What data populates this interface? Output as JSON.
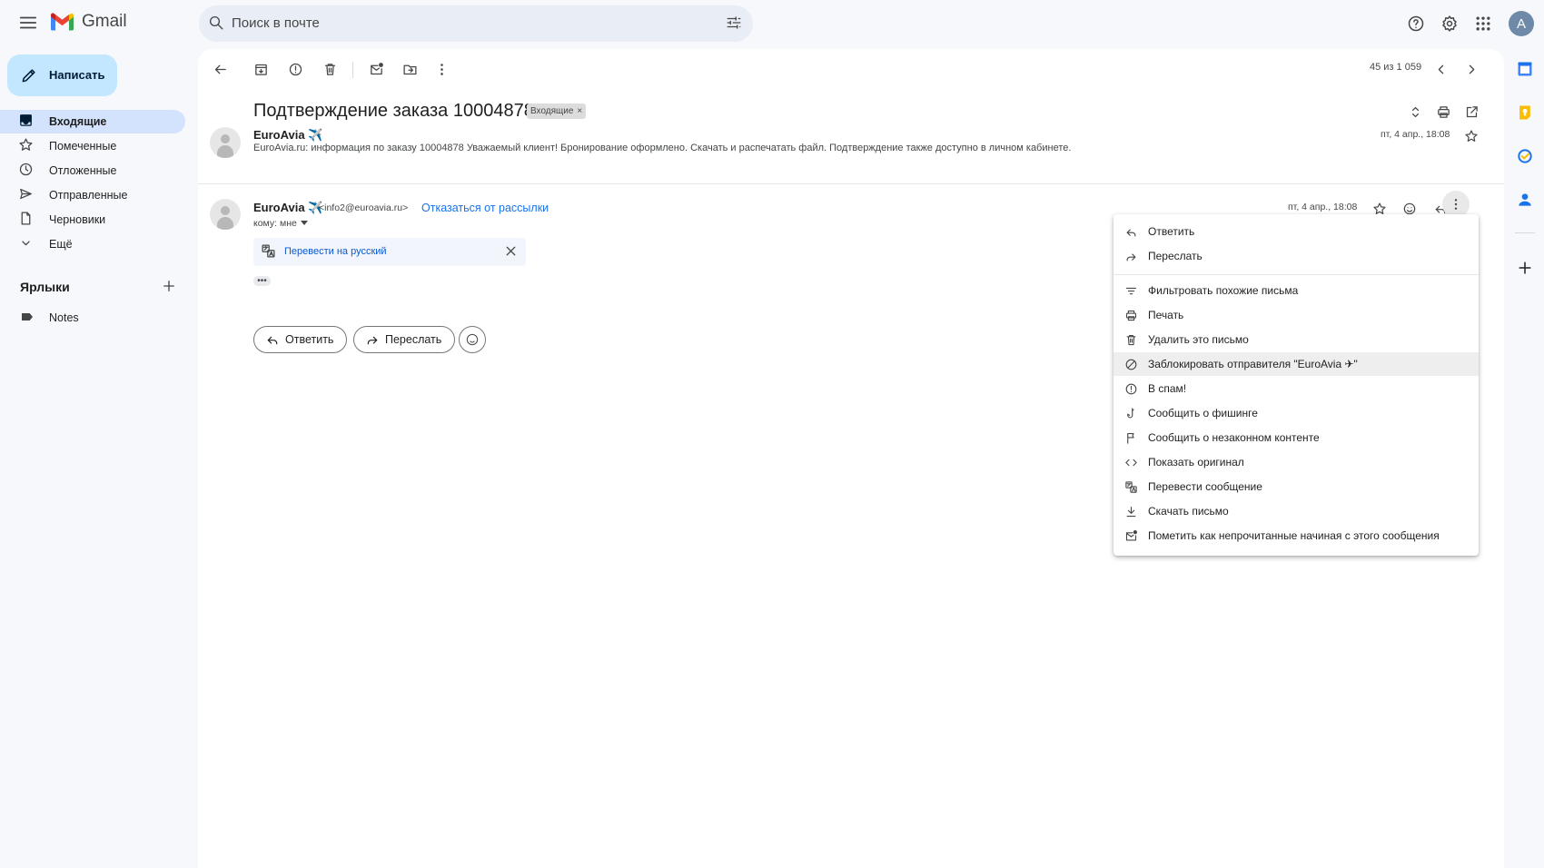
{
  "app": {
    "name": "Gmail"
  },
  "search": {
    "placeholder": "Поиск в почте"
  },
  "compose": {
    "label": "Написать"
  },
  "sidebar": {
    "items": [
      {
        "label": "Входящие",
        "icon": "inbox-icon",
        "active": true
      },
      {
        "label": "Помеченные",
        "icon": "star-icon"
      },
      {
        "label": "Отложенные",
        "icon": "clock-icon"
      },
      {
        "label": "Отправленные",
        "icon": "send-icon"
      },
      {
        "label": "Черновики",
        "icon": "draft-icon"
      },
      {
        "label": "Ещё",
        "icon": "chevron-down-icon"
      }
    ],
    "labels_title": "Ярлыки",
    "labels": [
      {
        "label": "Notes",
        "icon": "label-icon"
      }
    ]
  },
  "toolbar": {
    "pager": "45 из 1 059"
  },
  "thread": {
    "subject": "Подтверждение заказа 10004878",
    "chip": "Входящие",
    "chip_close": "×",
    "message1": {
      "sender": "EuroAvia ✈️",
      "snippet": "EuroAvia.ru: информация по заказу 10004878 Уважаемый клиент! Бронирование оформлено. Скачать и распечатать файл. Подтверждение также доступно в личном кабинете.",
      "date": "пт, 4 апр., 18:08"
    },
    "message2": {
      "sender": "EuroAvia ✈️",
      "email": "<info2@euroavia.ru>",
      "unsubscribe": "Отказаться от рассылки",
      "to": "кому: мне",
      "date": "пт, 4 апр., 18:08",
      "translate_link": "Перевести на русский",
      "more": "•••"
    },
    "reply_label": "Ответить",
    "forward_label": "Переслать"
  },
  "menu": {
    "items": [
      {
        "label": "Ответить",
        "icon": "reply-icon"
      },
      {
        "label": "Переслать",
        "icon": "forward-icon"
      },
      {
        "label": "Фильтровать похожие письма",
        "icon": "filter-icon"
      },
      {
        "label": "Печать",
        "icon": "print-icon"
      },
      {
        "label": "Удалить это письмо",
        "icon": "trash-icon"
      },
      {
        "label": "Заблокировать отправителя \"EuroAvia ✈\"",
        "icon": "block-icon",
        "highlighted": true
      },
      {
        "label": "В спам!",
        "icon": "spam-icon"
      },
      {
        "label": "Сообщить о фишинге",
        "icon": "phishing-hook-icon"
      },
      {
        "label": "Сообщить о незаконном контенте",
        "icon": "flag-icon"
      },
      {
        "label": "Показать оригинал",
        "icon": "code-icon"
      },
      {
        "label": "Перевести сообщение",
        "icon": "translate-icon"
      },
      {
        "label": "Скачать письмо",
        "icon": "download-icon"
      },
      {
        "label": "Пометить как непрочитанные начиная с этого сообщения",
        "icon": "mark-unread-icon"
      }
    ]
  },
  "avatar": {
    "letter": "A"
  },
  "colors": {
    "accent": "#c2e7ff",
    "active_nav": "#d3e3fd",
    "link": "#1a73e8",
    "background": "#f6f8fc"
  }
}
